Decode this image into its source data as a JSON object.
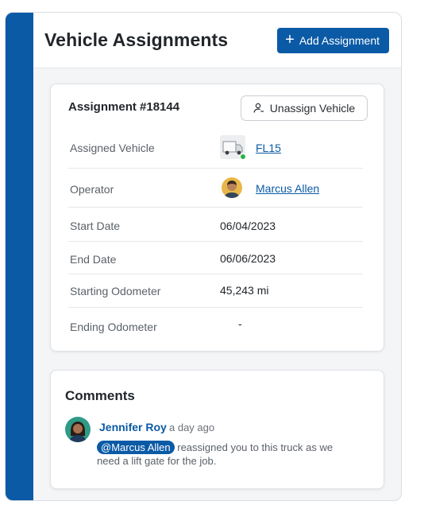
{
  "header": {
    "title": "Vehicle Assignments",
    "add_button_label": "Add Assignment"
  },
  "assignment": {
    "title": "Assignment #18144",
    "unassign_label": "Unassign Vehicle",
    "rows": [
      {
        "label": "Assigned Vehicle",
        "value": "FL15"
      },
      {
        "label": "Operator",
        "value": "Marcus Allen"
      },
      {
        "label": "Start Date",
        "value": "06/04/2023"
      },
      {
        "label": "End Date",
        "value": "06/06/2023"
      },
      {
        "label": "Starting Odometer",
        "value": "45,243 mi"
      },
      {
        "label": "Ending Odometer",
        "value": "-"
      }
    ]
  },
  "comments": {
    "title": "Comments",
    "items": [
      {
        "author": "Jennifer Roy",
        "time": "a day ago",
        "mention": "@Marcus Allen",
        "text": " reassigned you to this truck as we need a lift gate for the job."
      }
    ]
  },
  "colors": {
    "brand": "#0b5aa6",
    "online": "#29b24a"
  }
}
